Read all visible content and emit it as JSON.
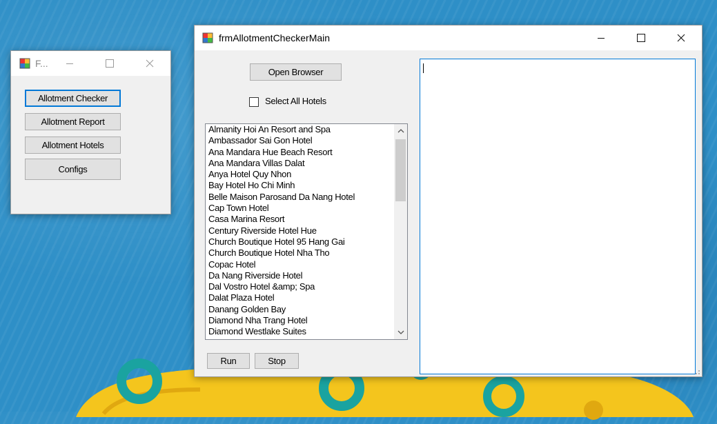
{
  "small_window": {
    "title": "F...",
    "buttons": [
      "Allotment Checker",
      "Allotment Report",
      "Allotment Hotels",
      "Configs"
    ]
  },
  "main_window": {
    "title": "frmAllotmentCheckerMain",
    "open_browser_label": "Open Browser",
    "select_all_label": "Select All Hotels",
    "select_all_checked": false,
    "hotels": [
      "Almanity Hoi An Resort and Spa",
      "Ambassador Sai Gon Hotel",
      "Ana Mandara Hue Beach Resort",
      "Ana Mandara Villas Dalat",
      "Anya Hotel Quy Nhon",
      "Bay Hotel Ho Chi Minh",
      "Belle Maison Parosand Da Nang Hotel",
      "Cap Town Hotel",
      "Casa Marina Resort",
      "Century Riverside Hotel Hue",
      "Church Boutique Hotel 95 Hang Gai",
      "Church Boutique Hotel Nha Tho",
      "Copac Hotel",
      "Da Nang Riverside Hotel",
      "Dal Vostro Hotel &amp; Spa",
      "Dalat Plaza Hotel",
      "Danang Golden Bay",
      "Diamond Nha Trang Hotel",
      "Diamond Westlake Suites"
    ],
    "run_label": "Run",
    "stop_label": "Stop",
    "output_text": ""
  },
  "icons": {
    "app": "app-icon",
    "minimize": "minimize-icon",
    "maximize": "maximize-icon",
    "close": "close-icon"
  },
  "colors": {
    "accent": "#0078d7",
    "desktop": "#2e8fc7"
  }
}
